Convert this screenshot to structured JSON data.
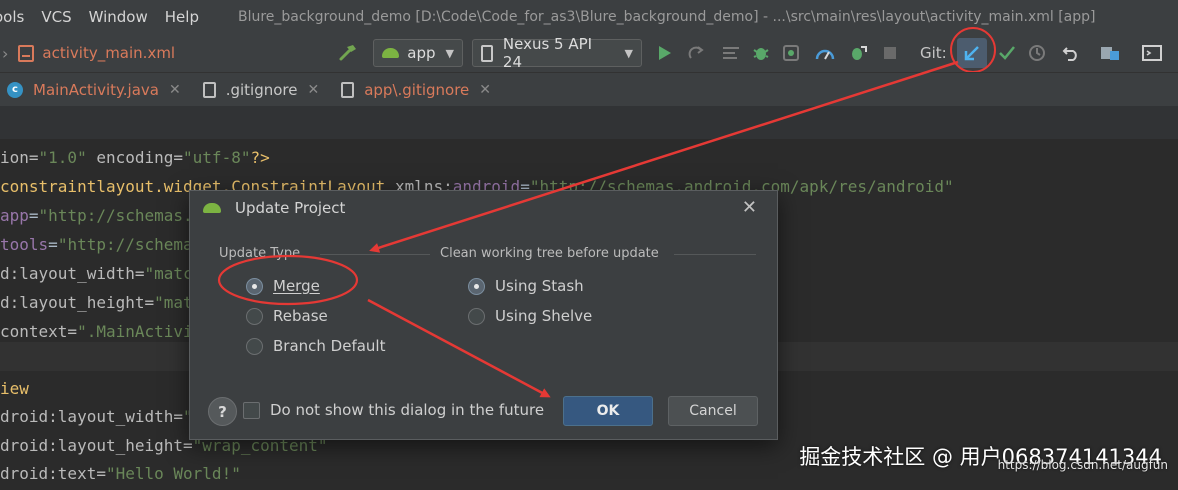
{
  "menubar": {
    "items": [
      "ools",
      "VCS",
      "Window",
      "Help"
    ],
    "window_title": "Blure_background_demo [D:\\Code\\Code_for_as3\\Blure_background_demo] - ...\\src\\main\\res\\layout\\activity_main.xml [app]"
  },
  "toolbar": {
    "breadcrumb_file": "activity_main.xml",
    "run_config": "app",
    "device": "Nexus 5 API 24",
    "git_label": "Git:"
  },
  "tabs": [
    {
      "label": "MainActivity.java",
      "color": "#d97a5b"
    },
    {
      "label": ".gitignore",
      "color": "#c8c8c8"
    },
    {
      "label": "app\\.gitignore",
      "color": "#d97a5b"
    }
  ],
  "code": {
    "l1": {
      "a": "ion=",
      "b": "\"1.0\"",
      "c": " encoding=",
      "d": "\"utf-8\"",
      "e": "?>"
    },
    "l2": {
      "tag": "constraintlayout.widget.ConstraintLayout ",
      "attr": "xmlns:",
      "ns": "android",
      "eq": "=",
      "val": "\"http://schemas.android.com/apk/res/android\""
    },
    "l3": {
      "ns": "app",
      "eq": "=",
      "val": "\"http://schemas."
    },
    "l4": {
      "ns": "tools",
      "eq": "=",
      "val": "\"http://schema"
    },
    "l5": {
      "attr": "d:layout_width=",
      "val": "\"matc"
    },
    "l6": {
      "attr": "d:layout_height=",
      "val": "\"mat"
    },
    "l7": {
      "attr": "context=",
      "val": "\".MainActivi"
    },
    "l8": {
      "tag": "iew"
    },
    "l9": {
      "attr": "droid:layout_width=",
      "val": "\""
    },
    "l10": {
      "attr": "droid:layout_height=",
      "val": "\"wrap_content\""
    },
    "l11": {
      "attr": "droid:text=",
      "val": "\"Hello World!\""
    }
  },
  "dialog": {
    "title": "Update Project",
    "update_type_label": "Update Type",
    "clean_label": "Clean working tree before update",
    "update_types": [
      {
        "label": "Merge",
        "selected": true
      },
      {
        "label": "Rebase",
        "selected": false
      },
      {
        "label": "Branch Default",
        "selected": false
      }
    ],
    "clean_options": [
      {
        "label": "Using Stash",
        "selected": true
      },
      {
        "label": "Using Shelve",
        "selected": false
      }
    ],
    "help": "?",
    "dont_show": "Do not show this dialog in the future",
    "ok": "OK",
    "cancel": "Cancel"
  },
  "watermark": {
    "text": "掘金技术社区 @ 用户068374141344",
    "url": "https://blog.csdn.net/augfun"
  },
  "colors": {
    "annotation_red": "#e53935",
    "ok_blue": "#365880",
    "android_green": "#7cb342"
  }
}
